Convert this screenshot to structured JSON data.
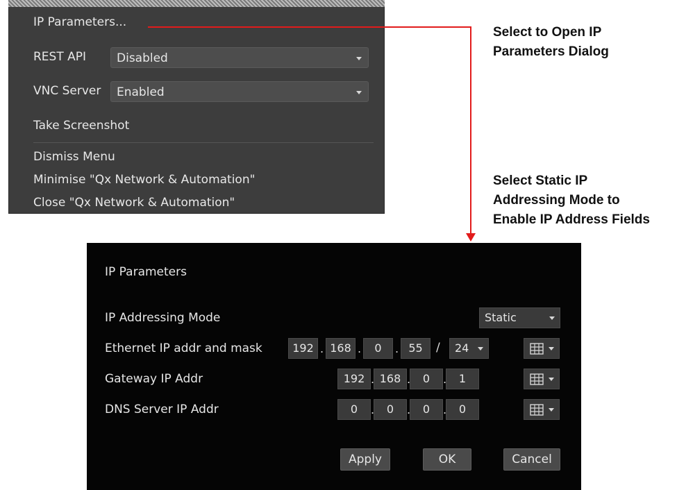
{
  "menu": {
    "ip_parameters": "IP Parameters...",
    "rest_api_label": "REST API",
    "rest_api_value": "Disabled",
    "vnc_label": "VNC Server",
    "vnc_value": "Enabled",
    "take_screenshot": "Take Screenshot",
    "dismiss": "Dismiss Menu",
    "minimise": "Minimise \"Qx Network & Automation\"",
    "close": "Close \"Qx Network & Automation\""
  },
  "annotations": {
    "open_dialog": [
      "Select to Open IP",
      "Parameters Dialog"
    ],
    "static_mode": [
      "Select Static IP",
      "Addressing Mode to",
      "Enable IP Address Fields"
    ],
    "accent": "#e21b1b"
  },
  "dialog": {
    "title": "IP Parameters",
    "mode_label": "IP Addressing Mode",
    "mode_value": "Static",
    "ethernet_label": "Ethernet IP addr and mask",
    "ethernet_octets": [
      "192",
      "168",
      "0",
      "55"
    ],
    "mask": "24",
    "gateway_label": "Gateway IP Addr",
    "gateway_octets": [
      "192",
      "168",
      "0",
      "1"
    ],
    "dns_label": "DNS Server IP Addr",
    "dns_octets": [
      "0",
      "0",
      "0",
      "0"
    ],
    "apply": "Apply",
    "ok": "OK",
    "cancel": "Cancel",
    "keypad_icon": "keypad-icon"
  }
}
